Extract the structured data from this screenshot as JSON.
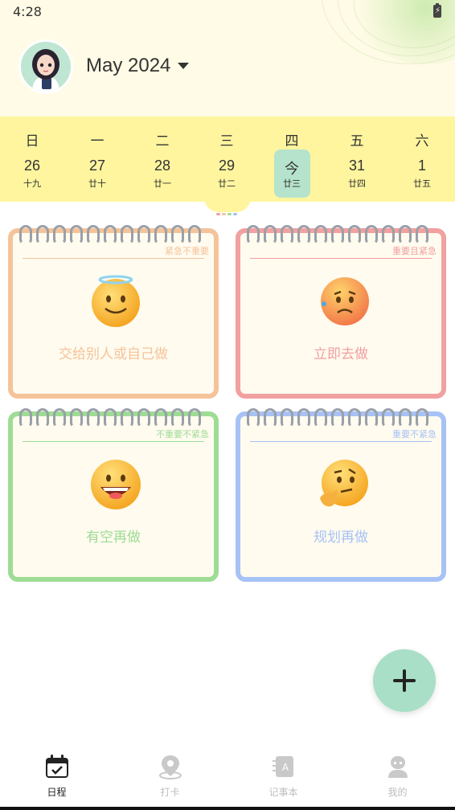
{
  "status_bar": {
    "time": "4:28"
  },
  "header": {
    "month_title": "May 2024"
  },
  "week": {
    "days": [
      {
        "weekday": "日",
        "day": "26",
        "lunar": "十九"
      },
      {
        "weekday": "一",
        "day": "27",
        "lunar": "廿十"
      },
      {
        "weekday": "二",
        "day": "28",
        "lunar": "廿一"
      },
      {
        "weekday": "三",
        "day": "29",
        "lunar": "廿二"
      },
      {
        "weekday": "四",
        "day": "今",
        "lunar": "廿三"
      },
      {
        "weekday": "五",
        "day": "31",
        "lunar": "廿四"
      },
      {
        "weekday": "六",
        "day": "1",
        "lunar": "廿五"
      }
    ]
  },
  "quadrants": [
    {
      "tag": "紧急不重要",
      "caption": "交给别人或自己做",
      "color": "#f5c39a",
      "emoji": "halo-smile-emoji"
    },
    {
      "tag": "重要且紧急",
      "caption": "立即去做",
      "color": "#f2a0a0",
      "emoji": "anxious-sweat-emoji"
    },
    {
      "tag": "不重要不紧急",
      "caption": "有空再做",
      "color": "#9edc95",
      "emoji": "grin-emoji"
    },
    {
      "tag": "重要不紧急",
      "caption": "规划再做",
      "color": "#a7c2f5",
      "emoji": "thinking-emoji"
    }
  ],
  "tabbar": {
    "items": [
      {
        "label": "日程",
        "icon": "calendar-check-icon",
        "active": true
      },
      {
        "label": "打卡",
        "icon": "location-pin-icon",
        "active": false
      },
      {
        "label": "记事本",
        "icon": "notebook-icon",
        "active": false
      },
      {
        "label": "我的",
        "icon": "profile-icon",
        "active": false
      }
    ]
  },
  "colors": {
    "header_bg": "#fffbe6",
    "week_strip_bg": "#fff59e",
    "today_highlight": "#b6e3cc",
    "fab_bg": "#a8dfc6"
  }
}
